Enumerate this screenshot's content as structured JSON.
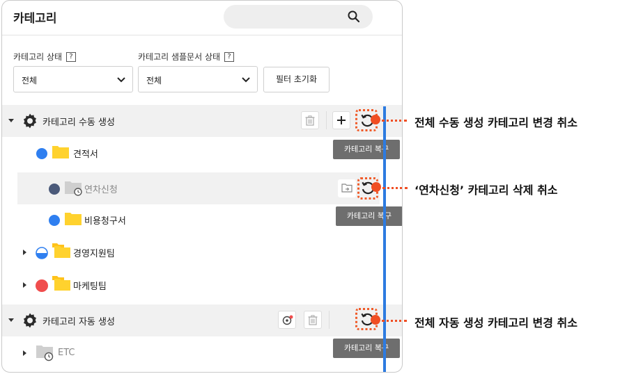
{
  "header": {
    "title": "카테고리",
    "search_placeholder": ""
  },
  "filters": {
    "status_label": "카테고리 상태",
    "status_help": "?",
    "status_value": "전체",
    "sample_label": "카테고리 샘플문서 상태",
    "sample_help": "?",
    "sample_value": "전체",
    "reset_label": "필터 초기화"
  },
  "tree": {
    "manual_group": "카테고리 수동 생성",
    "item_quote": "견적서",
    "item_vacation": "연차신청",
    "item_expense": "비용청구서",
    "item_mgmt": "경영지원팀",
    "item_marketing": "마케팅팀",
    "auto_group": "카테고리 자동 생성",
    "item_etc": "ETC"
  },
  "tooltips": {
    "restore1": "카테고리 복구",
    "restore2": "카테고리 복구",
    "restore3": "카테고리 복구"
  },
  "callouts": {
    "c1": "전체 수동 생성 카테고리 변경 취소",
    "c2": "‘연차신청’ 카테고리 삭제 취소",
    "c3": "전체 자동 생성 카테고리 변경 취소"
  },
  "colors": {
    "accent_blue": "#2d7be0",
    "callout_orange": "#f04e23",
    "folder_yellow": "#ffd22e",
    "dot_blue": "#2f7ff0",
    "dot_navy": "#4b5a7a",
    "dot_red": "#f04d4d"
  }
}
